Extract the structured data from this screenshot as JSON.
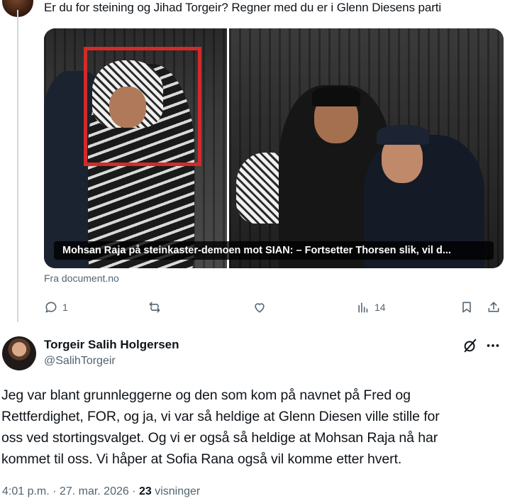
{
  "reply": {
    "text": "Er du for steining og Jihad Torgeir? Regner med du er i Glenn Diesens parti"
  },
  "link_card": {
    "caption": "Mohsan Raja på steinkaster-demoen mot SIAN: – Fortsetter Thorsen slik, vil d...",
    "source": "Fra document.no"
  },
  "actions": {
    "reply_count": "1",
    "retweet_count": "",
    "like_count": "",
    "views_count": "14"
  },
  "author": {
    "name": "Torgeir Salih Holgersen",
    "handle": "@SalihTorgeir"
  },
  "post": {
    "lines": [
      "Jeg var blant grunnleggerne og den som kom på navnet på Fred og",
      "Rettferdighet, FOR, og ja, vi var så heldige at Glenn Diesen ville stille for",
      "oss ved stortingsvalget. Og vi er også så heldige at Mohsan Raja nå har",
      "kommet til oss. Vi håper at Sofia Rana også vil komme etter hvert."
    ],
    "time": "4:01 p.m.",
    "sep1": " · ",
    "date": "27. mar. 2026",
    "sep2": " · ",
    "views": "23",
    "views_label": " visninger"
  },
  "icons": {
    "reply": "comment-icon",
    "retweet": "retweet-icon",
    "like": "heart-icon",
    "views": "analytics-icon",
    "bookmark": "bookmark-icon",
    "share": "share-icon",
    "grok": "grok-icon",
    "more": "more-icon"
  },
  "colors": {
    "text": "#0f1419",
    "secondary": "#536471",
    "thread_line": "#cfd9de",
    "highlight_box": "#d32a2a"
  }
}
